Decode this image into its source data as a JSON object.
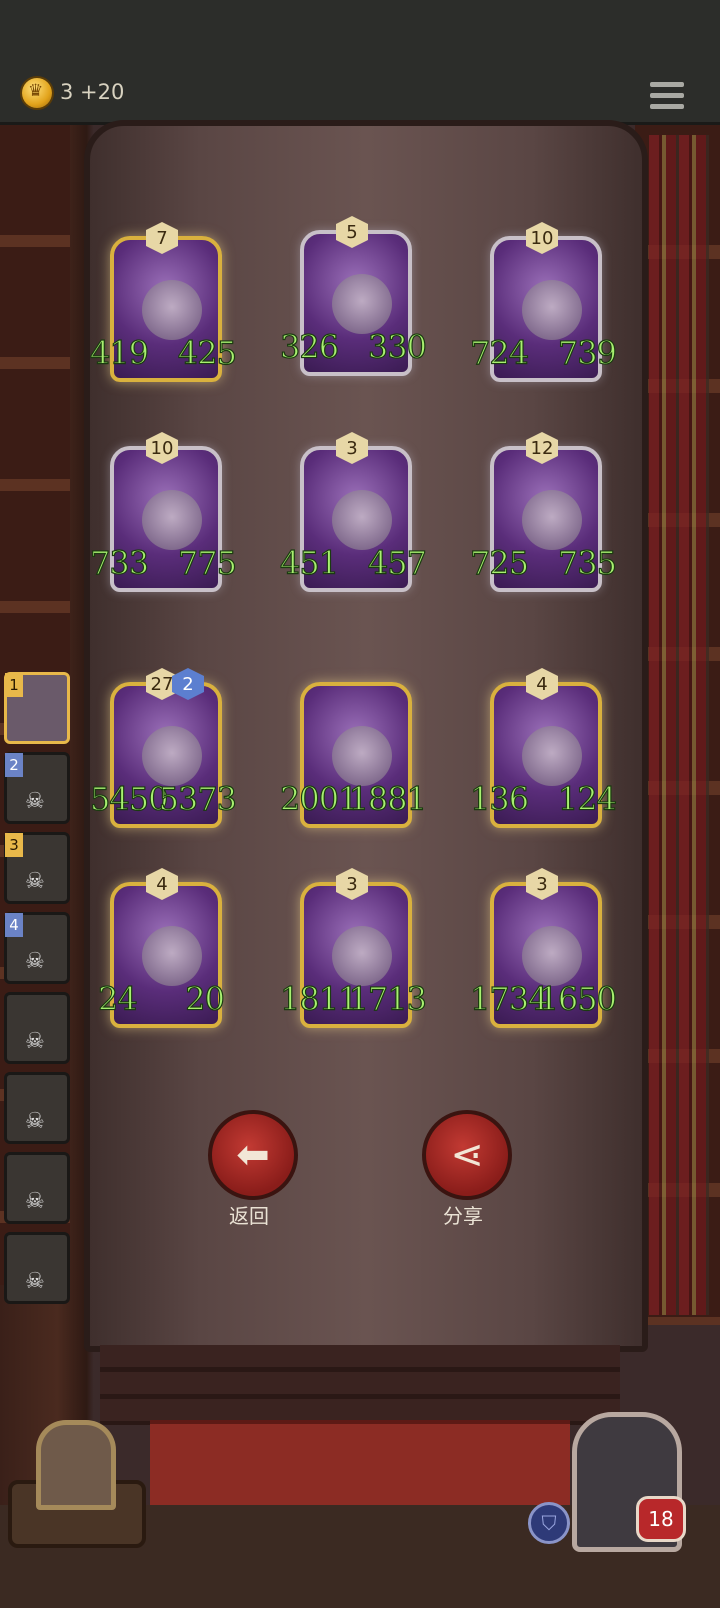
{
  "header": {
    "gold": "3 +20"
  },
  "cards": [
    {
      "level": "7",
      "atk": "419",
      "hp": "425",
      "frame": "gold"
    },
    {
      "level": "5",
      "atk": "326",
      "hp": "330",
      "frame": "silver"
    },
    {
      "level": "10",
      "atk": "724",
      "hp": "739",
      "frame": "silver"
    },
    {
      "level": "10",
      "atk": "733",
      "hp": "775",
      "frame": "silver"
    },
    {
      "level": "3",
      "atk": "451",
      "hp": "457",
      "frame": "silver"
    },
    {
      "level": "12",
      "atk": "725",
      "hp": "735",
      "frame": "silver"
    },
    {
      "level": "27",
      "atk": "5450",
      "hp": "5373",
      "frame": "gold",
      "badge": "2"
    },
    {
      "level": "",
      "atk": "2001",
      "hp": "1881",
      "frame": "gold"
    },
    {
      "level": "4",
      "atk": "136",
      "hp": "124",
      "frame": "gold"
    },
    {
      "level": "4",
      "atk": "24",
      "hp": "20",
      "frame": "gold"
    },
    {
      "level": "3",
      "atk": "1811",
      "hp": "1713",
      "frame": "gold"
    },
    {
      "level": "3",
      "atk": "1734",
      "hp": "1650",
      "frame": "gold"
    }
  ],
  "sidebar": [
    {
      "num": "1",
      "active": true
    },
    {
      "num": "2"
    },
    {
      "num": "3"
    },
    {
      "num": "4"
    },
    {
      "num": ""
    },
    {
      "num": ""
    },
    {
      "num": ""
    },
    {
      "num": ""
    }
  ],
  "actions": {
    "back": "返回",
    "share": "分享"
  },
  "player": {
    "health": "18"
  }
}
